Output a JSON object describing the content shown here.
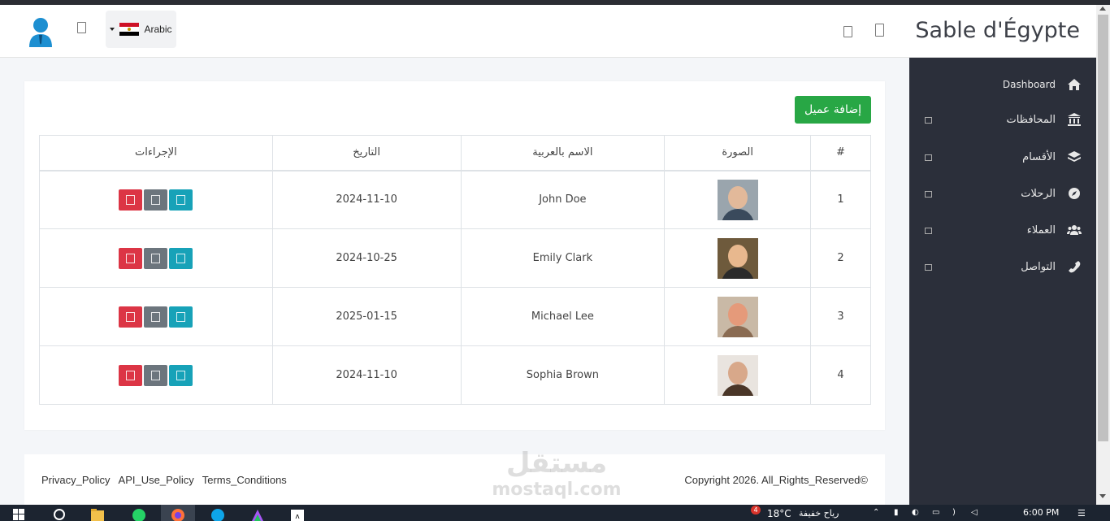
{
  "header": {
    "brand": "Sable d'Égypte",
    "language": "Arabic",
    "icons": [
      "user-avatar-icon",
      "fullscreen-icon",
      "flag-egypt-icon",
      "notification-icon",
      "message-icon"
    ]
  },
  "sidebar": {
    "items": [
      {
        "label": "Dashboard",
        "icon": "home-icon"
      },
      {
        "label": "المحافظات",
        "icon": "bank-icon"
      },
      {
        "label": "الأقسام",
        "icon": "layers-icon"
      },
      {
        "label": "الرحلات",
        "icon": "compass-icon"
      },
      {
        "label": "العملاء",
        "icon": "users-icon"
      },
      {
        "label": "التواصل",
        "icon": "phone-icon"
      }
    ]
  },
  "main": {
    "add_button": "إضافة عميل",
    "table": {
      "headers": [
        "#",
        "الصورة",
        "الاسم بالعربية",
        "التاريخ",
        "الإجراءات"
      ],
      "rows": [
        {
          "num": "1",
          "name": "John Doe",
          "date": "2024-11-10"
        },
        {
          "num": "2",
          "name": "Emily Clark",
          "date": "2024-10-25"
        },
        {
          "num": "3",
          "name": "Michael Lee",
          "date": "2025-01-15"
        },
        {
          "num": "4",
          "name": "Sophia Brown",
          "date": "2024-11-10"
        }
      ]
    }
  },
  "footer": {
    "links": [
      "Privacy_Policy",
      "API_Use_Policy",
      "Terms_Conditions"
    ],
    "copyright": "Copyright 2026. All_Rights_Reserved©"
  },
  "watermark": {
    "line1": "مستقل",
    "line2": "mostaql.com"
  },
  "taskbar": {
    "badge": "4",
    "temperature": "18°C",
    "weather": "رياح خفيفة",
    "time": "6:00 PM"
  },
  "colors": {
    "sidebar_bg": "#2b2f3a",
    "add_button": "#28a745",
    "delete_button": "#dc3545",
    "edit_button": "#6c757d",
    "view_button": "#17a2b8"
  }
}
